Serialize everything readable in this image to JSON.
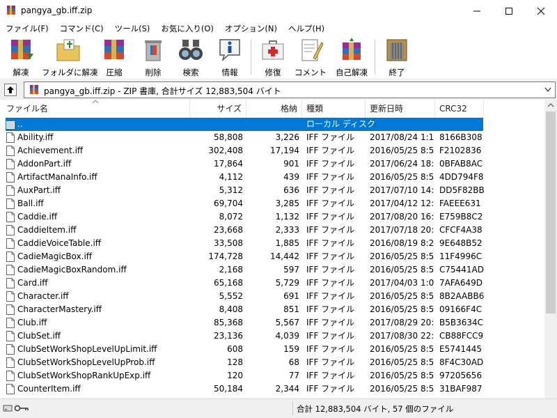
{
  "window": {
    "title": "pangya_gb.iff.zip"
  },
  "menu": [
    {
      "label": "ファイル(F)"
    },
    {
      "label": "コマンド(C)"
    },
    {
      "label": "ツール(S)"
    },
    {
      "label": "お気に入り(O)"
    },
    {
      "label": "オプション(N)"
    },
    {
      "label": "ヘルプ(H)"
    }
  ],
  "toolbar": {
    "extract": "解凍",
    "extract_to_folder": "フォルダに解凍",
    "compress": "圧縮",
    "delete": "削除",
    "find": "検索",
    "info": "情報",
    "repair": "修復",
    "comment": "コメント",
    "sfx": "自己解凍",
    "exit": "終了"
  },
  "address": {
    "text": "pangya_gb.iff.zip - ZIP 書庫, 合計サイズ 12,883,504 バイト"
  },
  "columns": {
    "name": "ファイル名",
    "size": "サイズ",
    "packed": "格納",
    "type": "種類",
    "modified": "更新日時",
    "crc": "CRC32"
  },
  "parent_row": {
    "name": "..",
    "type": "ローカル ディスク"
  },
  "files": [
    {
      "name": "Ability.iff",
      "size": "58,808",
      "packed": "3,226",
      "type": "IFF ファイル",
      "modified": "2017/08/24 1:16",
      "crc": "8166B308"
    },
    {
      "name": "Achievement.iff",
      "size": "302,408",
      "packed": "17,194",
      "type": "IFF ファイル",
      "modified": "2016/05/25 8:57",
      "crc": "F2102836"
    },
    {
      "name": "AddonPart.iff",
      "size": "17,864",
      "packed": "901",
      "type": "IFF ファイル",
      "modified": "2017/06/24 18:25",
      "crc": "0BFAB8AC"
    },
    {
      "name": "ArtifactManaInfo.iff",
      "size": "4,112",
      "packed": "439",
      "type": "IFF ファイル",
      "modified": "2016/05/25 8:57",
      "crc": "4DD794F8"
    },
    {
      "name": "AuxPart.iff",
      "size": "5,312",
      "packed": "636",
      "type": "IFF ファイル",
      "modified": "2017/07/10 14:22",
      "crc": "DD5F82BB"
    },
    {
      "name": "Ball.iff",
      "size": "69,704",
      "packed": "3,285",
      "type": "IFF ファイル",
      "modified": "2017/04/12 12:43",
      "crc": "FAEEE631"
    },
    {
      "name": "Caddie.iff",
      "size": "8,072",
      "packed": "1,132",
      "type": "IFF ファイル",
      "modified": "2017/08/20 16:52",
      "crc": "E759B8C2"
    },
    {
      "name": "CaddieItem.iff",
      "size": "23,668",
      "packed": "2,333",
      "type": "IFF ファイル",
      "modified": "2017/07/18 20:13",
      "crc": "CFCF4A38"
    },
    {
      "name": "CaddieVoiceTable.iff",
      "size": "33,508",
      "packed": "1,885",
      "type": "IFF ファイル",
      "modified": "2016/08/19 8:25",
      "crc": "9E648B52"
    },
    {
      "name": "CadieMagicBox.iff",
      "size": "174,728",
      "packed": "14,442",
      "type": "IFF ファイル",
      "modified": "2016/05/25 8:57",
      "crc": "11F4996C"
    },
    {
      "name": "CadieMagicBoxRandom.iff",
      "size": "2,168",
      "packed": "597",
      "type": "IFF ファイル",
      "modified": "2016/05/25 8:57",
      "crc": "C75441AD"
    },
    {
      "name": "Card.iff",
      "size": "65,168",
      "packed": "5,729",
      "type": "IFF ファイル",
      "modified": "2017/04/03 1:09",
      "crc": "7AFA649D"
    },
    {
      "name": "Character.iff",
      "size": "5,552",
      "packed": "691",
      "type": "IFF ファイル",
      "modified": "2016/05/25 8:57",
      "crc": "8B2AABB6"
    },
    {
      "name": "CharacterMastery.iff",
      "size": "8,408",
      "packed": "851",
      "type": "IFF ファイル",
      "modified": "2016/05/25 8:57",
      "crc": "09166F4C"
    },
    {
      "name": "Club.iff",
      "size": "85,368",
      "packed": "5,567",
      "type": "IFF ファイル",
      "modified": "2017/08/29 20:41",
      "crc": "B5B3634C"
    },
    {
      "name": "ClubSet.iff",
      "size": "23,136",
      "packed": "4,039",
      "type": "IFF ファイル",
      "modified": "2017/08/30 22:28",
      "crc": "CB88FCC9"
    },
    {
      "name": "ClubSetWorkShopLevelUpLimit.iff",
      "size": "608",
      "packed": "159",
      "type": "IFF ファイル",
      "modified": "2016/05/25 8:57",
      "crc": "E5741445"
    },
    {
      "name": "ClubSetWorkShopLevelUpProb.iff",
      "size": "128",
      "packed": "68",
      "type": "IFF ファイル",
      "modified": "2016/05/25 8:57",
      "crc": "8F4C30AD"
    },
    {
      "name": "ClubSetWorkShopRankUpExp.iff",
      "size": "120",
      "packed": "77",
      "type": "IFF ファイル",
      "modified": "2016/05/25 8:57",
      "crc": "97205656"
    },
    {
      "name": "CounterItem.iff",
      "size": "50,184",
      "packed": "2,344",
      "type": "IFF ファイル",
      "modified": "2016/05/25 8:57",
      "crc": "31BAF987"
    }
  ],
  "status": {
    "text": "合計 12,883,504 バイト, 57 個のファイル"
  }
}
